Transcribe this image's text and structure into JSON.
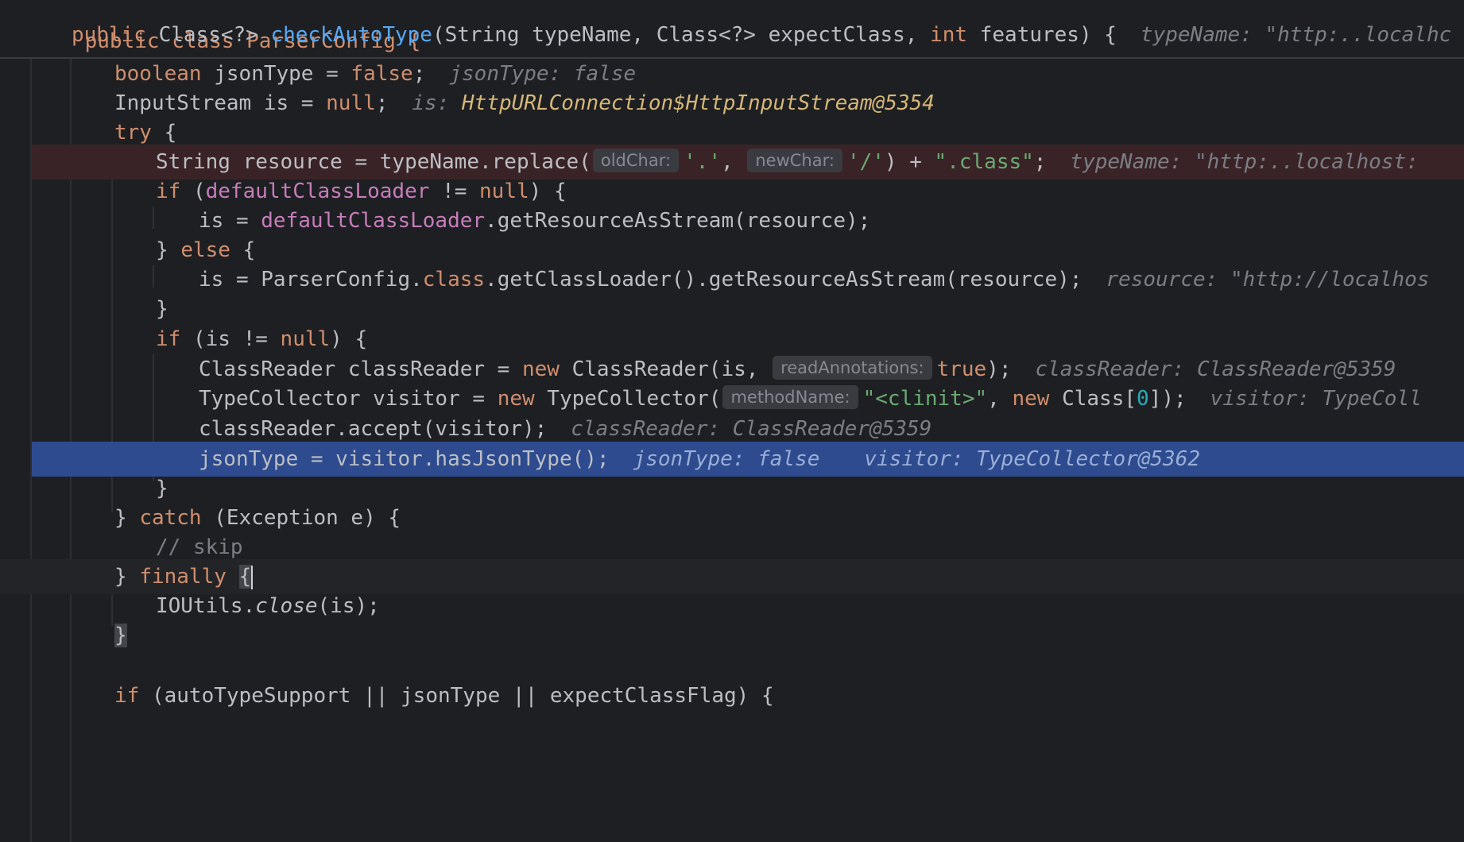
{
  "sticky": {
    "line1": [
      "public class ParserConfig {"
    ],
    "line2": {
      "kw_public": "public",
      "type": "Class<?>",
      "method": "checkAutoType",
      "params_pre": "(String typeName, Class<?> expectClass, ",
      "kw_int": "int",
      "params_post": " features) {",
      "hint": "typeName: \"http:..localhc"
    },
    "line1_text": "public class ParserConfig {"
  },
  "lines": {
    "l1": {
      "kw": "boolean",
      "code": " jsonType = ",
      "kw2": "false",
      "end": ";",
      "hint": "jsonType: false"
    },
    "l2": {
      "code": "InputStream is = ",
      "kw": "null",
      "end": ";",
      "hint_label": "is: ",
      "hint_value": "HttpURLConnection$HttpInputStream@5354"
    },
    "l3": {
      "kw": "try",
      "end": " {"
    },
    "l4": {
      "code1": "String resource = typeName.replace(",
      "p1": "oldChar:",
      "s1": "'.'",
      "sep": ", ",
      "p2": "newChar:",
      "s2": "'/'",
      "code2": ") + ",
      "s3": "\".class\"",
      "end": ";",
      "hint": "typeName: \"http:..localhost:"
    },
    "l5": {
      "kw": "if",
      "code1": " (",
      "fld": "defaultClassLoader",
      "code2": " != ",
      "kw2": "null",
      "end": ") {"
    },
    "l6": {
      "code1": "is = ",
      "fld": "defaultClassLoader",
      "code2": ".getResourceAsStream(resource);"
    },
    "l7": {
      "code1": "} ",
      "kw": "else",
      "end": " {"
    },
    "l8": {
      "code1": "is = ParserConfig.",
      "kw": "class",
      "code2": ".getClassLoader().getResourceAsStream(resource);",
      "hint": "resource: \"http://localhos"
    },
    "l9": {
      "code": "}"
    },
    "l10": {
      "kw": "if",
      "code1": " (is != ",
      "kw2": "null",
      "end": ") {"
    },
    "l11": {
      "code1": "ClassReader classReader = ",
      "kw": "new",
      "code2": " ClassReader(is, ",
      "p1": "readAnnotations:",
      "kw2": "true",
      "end": ");",
      "hint": "classReader: ClassReader@5359"
    },
    "l12": {
      "code1": "TypeCollector visitor = ",
      "kw": "new",
      "code2": " TypeCollector(",
      "p1": "methodName:",
      "s1": "\"<clinit>\"",
      "sep": ", ",
      "kw2": "new",
      "code3": " Class[",
      "num": "0",
      "end": "]);",
      "hint": "visitor: TypeColl"
    },
    "l13": {
      "code": "classReader.accept(visitor);",
      "hint": "classReader: ClassReader@5359"
    },
    "l14": {
      "code": "jsonType = visitor.hasJsonType();",
      "hint1": "jsonType: false",
      "hint2": "visitor: TypeCollector@5362"
    },
    "l15": {
      "code": "}"
    },
    "l16": {
      "code1": "} ",
      "kw": "catch",
      "code2": " (Exception e) {"
    },
    "l17": {
      "cm": "// skip"
    },
    "l18": {
      "code1": "} ",
      "kw": "finally",
      "sp": " ",
      "brace": "{"
    },
    "l19": {
      "code1": "IOUtils.",
      "it": "close",
      "code2": "(is);"
    },
    "l20": {
      "brace": "}"
    },
    "l22": {
      "kw": "if",
      "code": " (autoTypeSupport || jsonType || expectClassFlag) {"
    }
  },
  "colors": {
    "background": "#1e1f22",
    "keyword": "#cf8e6d",
    "method": "#56a8f5",
    "field": "#c77dbb",
    "string": "#6aab73",
    "number": "#2aacb8",
    "execution_line": "#2d4b8e",
    "breakpoint_line": "#3a2326"
  }
}
